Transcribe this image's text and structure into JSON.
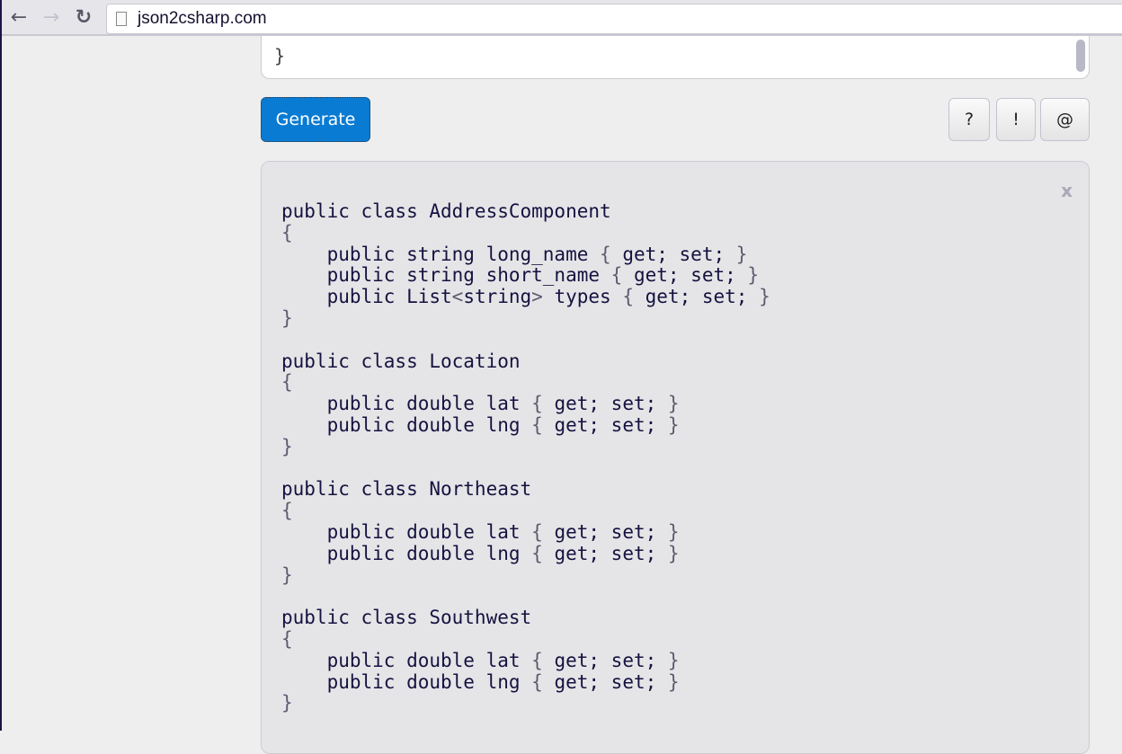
{
  "browser": {
    "url": "json2csharp.com",
    "back_icon": "arrow-left-icon",
    "forward_icon": "arrow-right-icon",
    "reload_icon": "reload-icon"
  },
  "json_input": {
    "visible_text": "}"
  },
  "buttons": {
    "generate": "Generate",
    "help": "?",
    "info": "!",
    "contact": "@",
    "close": "x"
  },
  "colors": {
    "generate_bg": "#0a7bd3"
  },
  "output": {
    "lines": [
      "public class AddressComponent",
      "{",
      "    public string long_name { get; set; }",
      "    public string short_name { get; set; }",
      "    public List<string> types { get; set; }",
      "}",
      "",
      "public class Location",
      "{",
      "    public double lat { get; set; }",
      "    public double lng { get; set; }",
      "}",
      "",
      "public class Northeast",
      "{",
      "    public double lat { get; set; }",
      "    public double lng { get; set; }",
      "}",
      "",
      "public class Southwest",
      "{",
      "    public double lat { get; set; }",
      "    public double lng { get; set; }",
      "}"
    ]
  }
}
